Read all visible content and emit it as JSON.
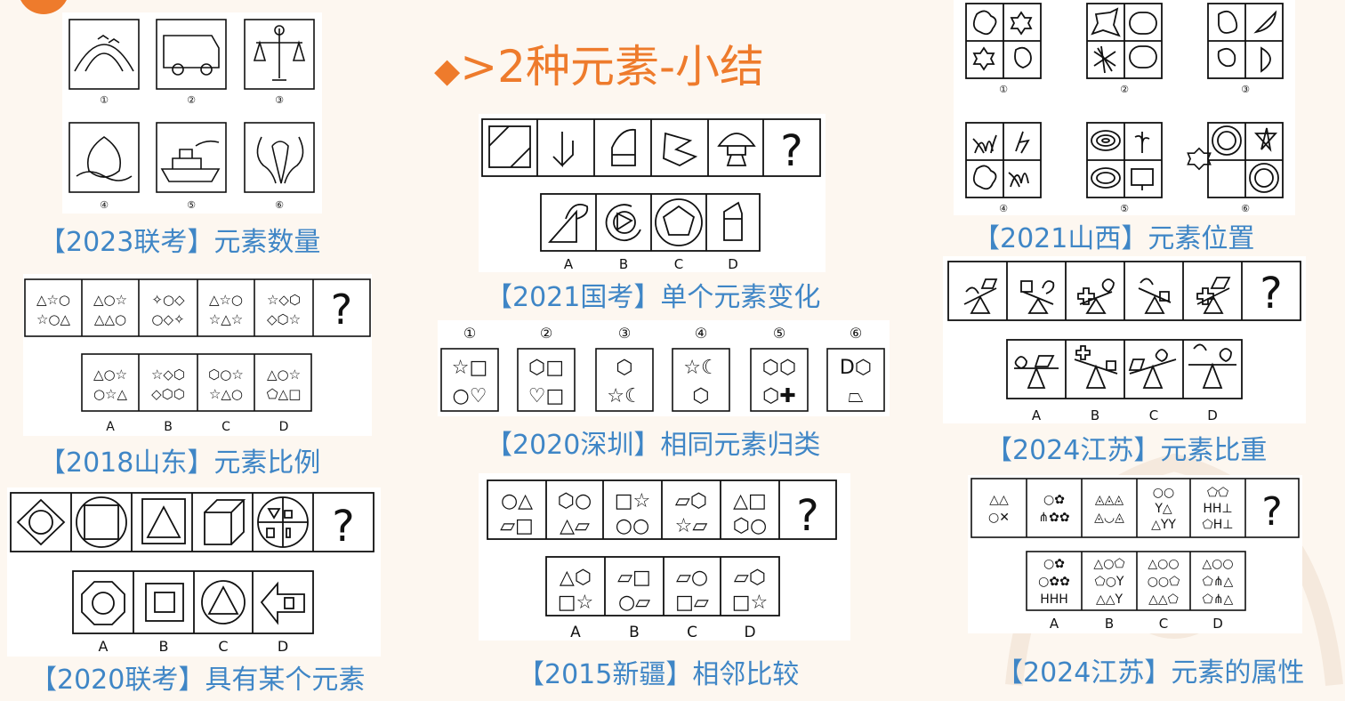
{
  "title": {
    "diamond": "◆",
    "text": ">2种元素-小结"
  },
  "captions": {
    "c1": "【2023联考】元素数量",
    "c2": "【2018山东】元素比例",
    "c3": "【2020联考】具有某个元素",
    "c4": "【2021国考】单个元素变化",
    "c5": "【2020深圳】相同元素归类",
    "c6": "【2015新疆】相邻比较",
    "c7": "【2021山西】元素位置",
    "c8": "【2024江苏】元素比重",
    "c9": "【2024江苏】元素的属性"
  },
  "puzzles": {
    "p1": {
      "nums": [
        "①",
        "②",
        "③",
        "④",
        "⑤",
        "⑥"
      ]
    },
    "p2": {
      "cells": [
        [
          "△☆○",
          "☆○△"
        ],
        [
          "△○☆",
          "△△○"
        ],
        [
          "✧○◇",
          "○◇✧"
        ],
        [
          "△☆○",
          "☆△☆"
        ],
        [
          "☆◇⬡",
          "◇⬡☆"
        ]
      ],
      "q": "?",
      "opts": [
        [
          "△○☆",
          "○☆△"
        ],
        [
          "☆◇⬡",
          "◇⬡⬡"
        ],
        [
          "⬡○☆",
          "☆△○"
        ],
        [
          "△○☆",
          "⬠△□"
        ]
      ],
      "letters": [
        "A",
        "B",
        "C",
        "D"
      ]
    },
    "p3": {
      "q": "?",
      "letters": [
        "A",
        "B",
        "C",
        "D"
      ]
    },
    "p4": {
      "q": "?",
      "letters": [
        "A",
        "B",
        "C",
        "D"
      ]
    },
    "p5": {
      "nums": [
        "①",
        "②",
        "③",
        "④",
        "⑤",
        "⑥"
      ],
      "cells": [
        [
          "☆□",
          "○♡"
        ],
        [
          "⬡□",
          "♡□"
        ],
        [
          "⬡",
          "☆☾"
        ],
        [
          "☆☾",
          "⬡"
        ],
        [
          "⬡⬡",
          "⬡✚"
        ],
        [
          "D⬡",
          "⏢"
        ]
      ]
    },
    "p6": {
      "cells": [
        [
          "○△",
          "⏥□"
        ],
        [
          "⬡○",
          "△⏥"
        ],
        [
          "□☆",
          "○○"
        ],
        [
          "⏥⬡",
          "☆⏥"
        ],
        [
          "△□",
          "⬡○"
        ]
      ],
      "q": "?",
      "opts": [
        [
          "△⬡",
          "□☆"
        ],
        [
          "⏥□",
          "○⏥"
        ],
        [
          "⏥○",
          "□⏥"
        ],
        [
          "⏥⬡",
          "□☆"
        ]
      ],
      "letters": [
        "A",
        "B",
        "C",
        "D"
      ]
    },
    "p7": {
      "nums": [
        "①",
        "②",
        "③",
        "④",
        "⑤",
        "⑥"
      ]
    },
    "p8": {
      "q": "?",
      "letters": [
        "A",
        "B",
        "C",
        "D"
      ]
    },
    "p9": {
      "cells": [
        [
          "△△",
          "○✕"
        ],
        [
          "○✿",
          "⋔✿✿"
        ],
        [
          "◬◬◬",
          "◬◡◬"
        ],
        [
          "○○",
          "Y△",
          "△YY"
        ],
        [
          "⬠⬠",
          "HH⊥",
          "⬠H⊥"
        ]
      ],
      "q": "?",
      "opts": [
        [
          "○✿",
          "○✿✿",
          "HHH"
        ],
        [
          "△○⬠",
          "⬠○Y",
          "△△Y"
        ],
        [
          "△○○",
          "○○⬠",
          "△△⬠"
        ],
        [
          "△○○",
          "⬠⋔△",
          "⬠⋔△"
        ]
      ],
      "letters": [
        "A",
        "B",
        "C",
        "D"
      ]
    }
  },
  "colors": {
    "accent": "#ee7b2c",
    "caption": "#3f86c6",
    "background": "#fdf7f0"
  }
}
